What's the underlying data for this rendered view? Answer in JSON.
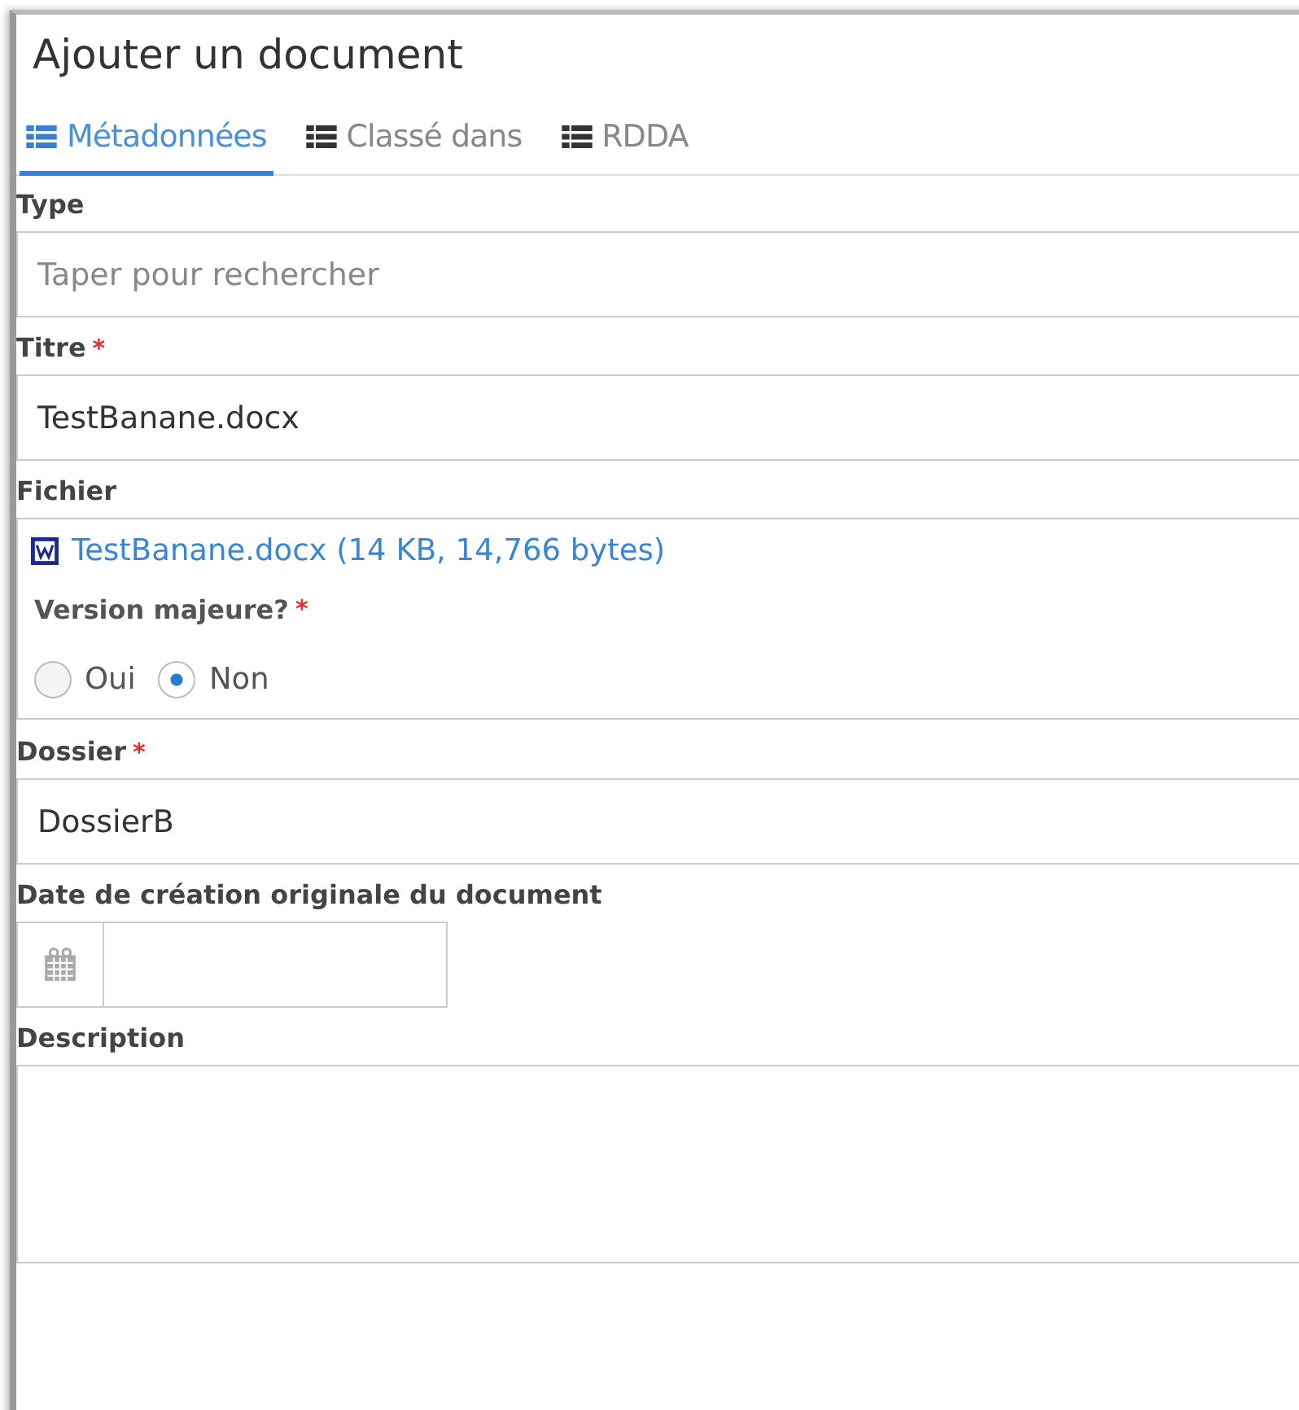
{
  "window": {
    "title": "Ajouter un document"
  },
  "tabs": [
    {
      "label": "Métadonnées",
      "selected": true
    },
    {
      "label": "Classé dans",
      "selected": false
    },
    {
      "label": "RDDA",
      "selected": false
    }
  ],
  "fields": [
    {
      "kind": "text",
      "label": "Type",
      "placeholder": "Taper pour rechercher"
    },
    {
      "kind": "text",
      "label": "Titre",
      "required_mark": "*",
      "value": "TestBanane.docx"
    },
    {
      "kind": "file",
      "label": "Fichier",
      "file_link": "TestBanane.docx (14 KB, 14,766 bytes)",
      "version_label": "Version majeure?",
      "version_required_mark": "*",
      "options": [
        {
          "label": "Oui",
          "selected": false
        },
        {
          "label": "Non",
          "selected": true
        }
      ]
    },
    {
      "kind": "text",
      "label": "Dossier",
      "required_mark": "*",
      "value": "DossierB"
    },
    {
      "kind": "date",
      "label": "Date de création originale du document"
    },
    {
      "kind": "textarea",
      "label": "Description"
    }
  ]
}
